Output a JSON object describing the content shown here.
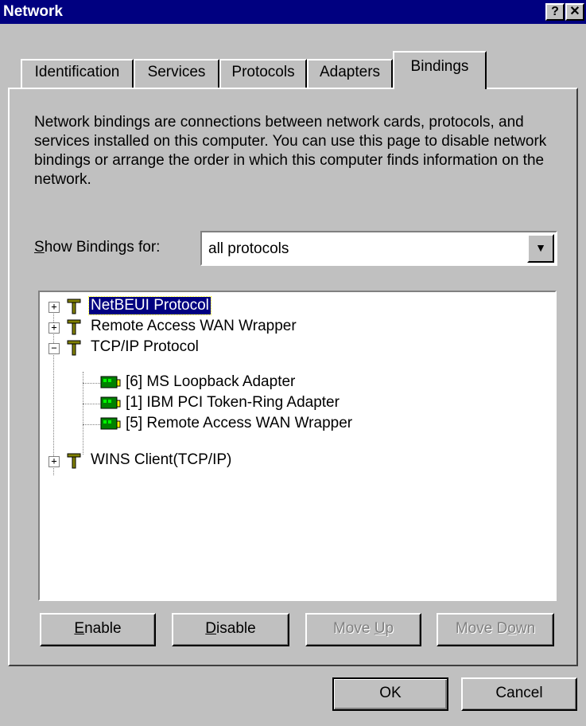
{
  "window": {
    "title": "Network",
    "help_glyph": "?",
    "close_glyph": "✕"
  },
  "tabs": [
    {
      "label": "Identification",
      "active": false
    },
    {
      "label": "Services",
      "active": false
    },
    {
      "label": "Protocols",
      "active": false
    },
    {
      "label": "Adapters",
      "active": false
    },
    {
      "label": "Bindings",
      "active": true
    }
  ],
  "description": "Network bindings are connections between network cards, protocols, and services installed on this computer.  You can use this page to disable network bindings or arrange the order in which this computer finds information on the network.",
  "show_bindings": {
    "label_accel": "S",
    "label_rest": "how Bindings for:",
    "value": "all protocols",
    "arrow_glyph": "▼"
  },
  "tree": [
    {
      "label": "NetBEUI Protocol",
      "expander": "+",
      "icon": "protocol-icon",
      "selected": true
    },
    {
      "label": "Remote Access WAN Wrapper",
      "expander": "+",
      "icon": "protocol-icon",
      "selected": false
    },
    {
      "label": "TCP/IP Protocol",
      "expander": "−",
      "icon": "protocol-icon",
      "selected": false,
      "children": [
        {
          "label": "[6] MS Loopback Adapter",
          "icon": "network-card-icon"
        },
        {
          "label": "[1] IBM PCI Token-Ring Adapter",
          "icon": "network-card-icon"
        },
        {
          "label": "[5] Remote Access WAN Wrapper",
          "icon": "network-card-icon"
        }
      ]
    },
    {
      "label": "WINS Client(TCP/IP)",
      "expander": "+",
      "icon": "protocol-icon",
      "selected": false
    }
  ],
  "buttons": {
    "enable": {
      "accel": "E",
      "rest": "nable",
      "enabled": true
    },
    "disable": {
      "accel": "D",
      "rest": "isable",
      "enabled": true
    },
    "move_up": {
      "before": "Move ",
      "accel": "U",
      "after": "p",
      "enabled": false
    },
    "move_down": {
      "before": "Move D",
      "accel": "o",
      "after": "wn",
      "enabled": false
    },
    "ok": "OK",
    "cancel": "Cancel"
  }
}
